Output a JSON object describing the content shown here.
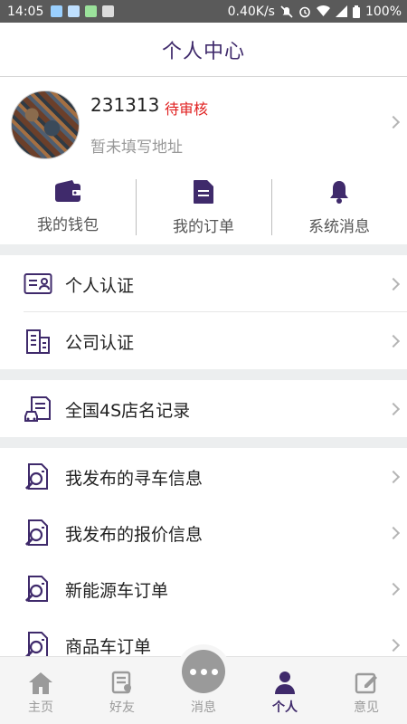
{
  "status_bar": {
    "time": "14:05",
    "speed": "0.40K/s",
    "battery": "100%"
  },
  "header": {
    "title": "个人中心"
  },
  "profile": {
    "username": "231313",
    "status": "待审核",
    "address": "暂未填写地址"
  },
  "quick_actions": [
    {
      "label": "我的钱包",
      "icon": "wallet-icon"
    },
    {
      "label": "我的订单",
      "icon": "document-icon"
    },
    {
      "label": "系统消息",
      "icon": "bell-icon"
    }
  ],
  "menu": {
    "personal_cert": "个人认证",
    "company_cert": "公司认证",
    "dealer_record": "全国4S店名记录",
    "my_search": "我发布的寻车信息",
    "my_quote": "我发布的报价信息",
    "new_energy": "新能源车订单",
    "commodity": "商品车订单"
  },
  "bottom_nav": [
    {
      "label": "主页",
      "icon": "home-icon"
    },
    {
      "label": "好友",
      "icon": "friends-icon"
    },
    {
      "label": "消息",
      "icon": "message-icon"
    },
    {
      "label": "个人",
      "icon": "person-icon",
      "active": true
    },
    {
      "label": "意见",
      "icon": "feedback-icon"
    }
  ],
  "colors": {
    "accent": "#3f2a6b",
    "status_red": "#e02020",
    "status_bar": "#5a5a5a"
  }
}
